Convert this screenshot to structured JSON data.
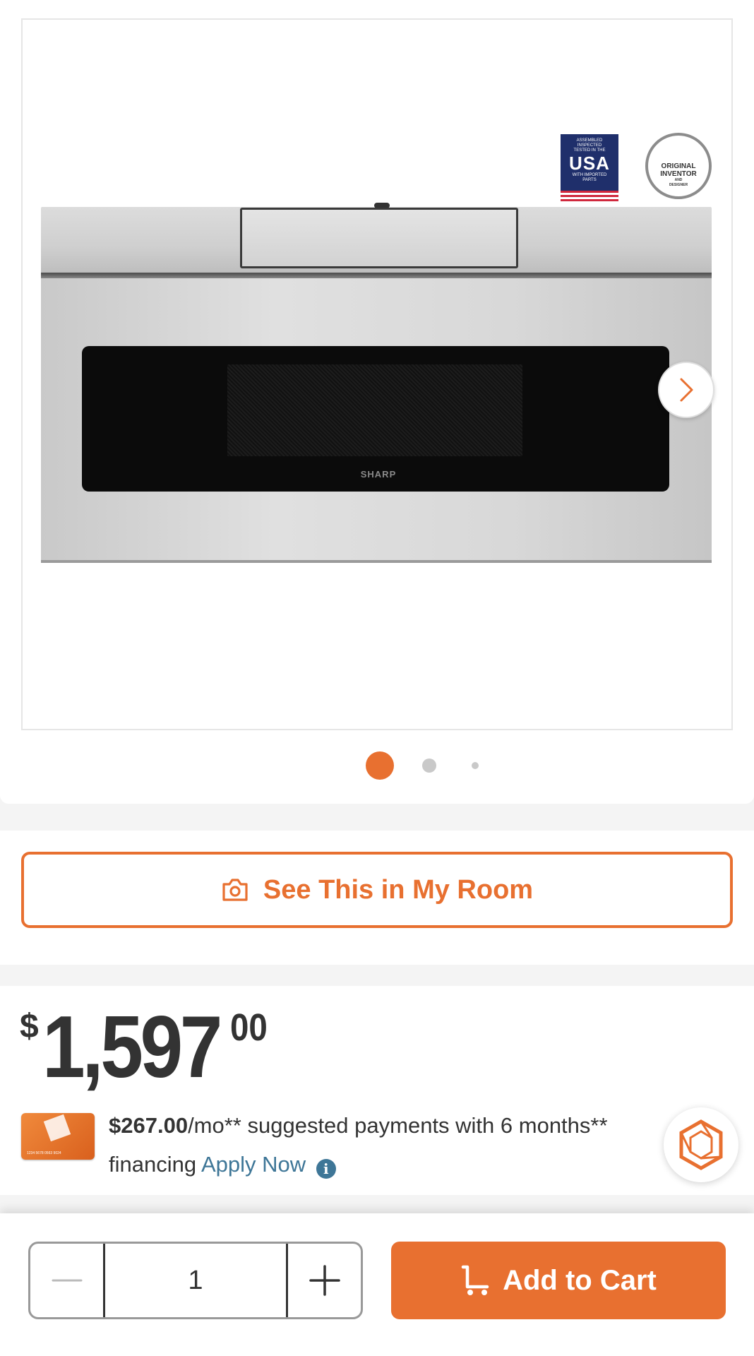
{
  "gallery": {
    "brand_text": "SHARP",
    "badge_usa": {
      "line1": "ASSEMBLED",
      "line2": "INSPECTED",
      "line3": "TESTED IN THE",
      "big": "USA",
      "line4": "WITH IMPORTED",
      "line5": "PARTS"
    },
    "badge_original": {
      "line1": "ORIGINAL",
      "line2": "INVENTOR",
      "line3": "AND",
      "line4": "DESIGNER"
    },
    "active_dot": 1,
    "dot_count": 3
  },
  "room": {
    "label": "See This in My Room"
  },
  "price": {
    "currency": "$",
    "dollars": "1,597",
    "cents": "00"
  },
  "financing": {
    "monthly": "$267.00",
    "text_part1": "/mo** suggested payments with 6 months**",
    "text_part2": "financing",
    "apply_label": "Apply Now",
    "info_glyph": "i",
    "card_number": "1234 5678 0563 9024"
  },
  "cart": {
    "quantity": "1",
    "add_label": "Add to Cart"
  },
  "colors": {
    "accent": "#e87030",
    "link": "#3e7697",
    "text": "#333333"
  }
}
